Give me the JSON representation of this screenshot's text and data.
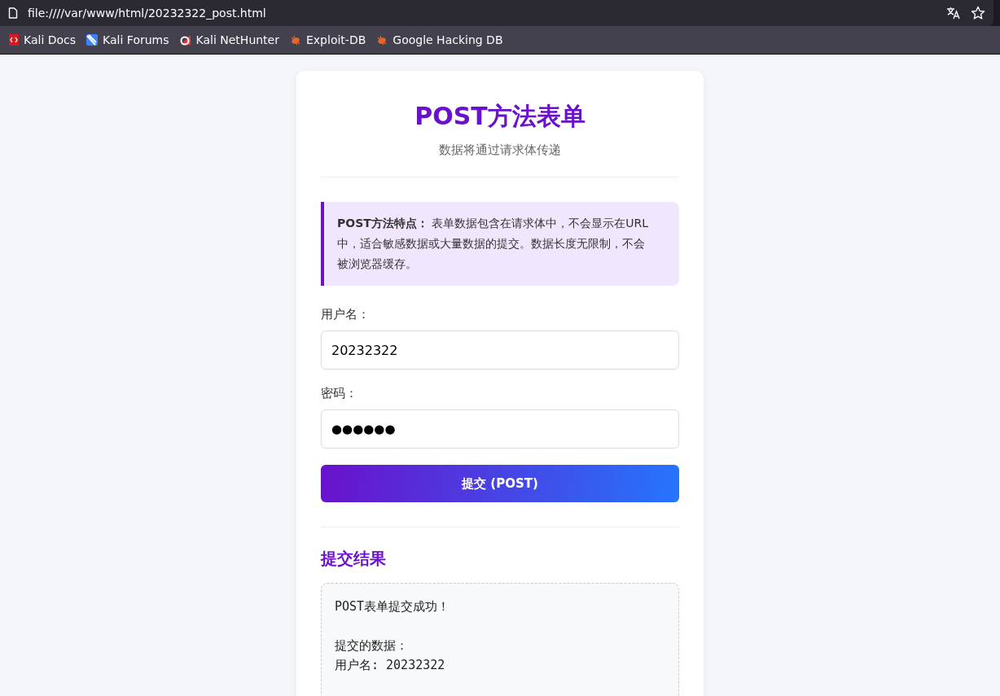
{
  "address_bar": {
    "url": "file:////var/www/html/20232322_post.html"
  },
  "bookmarks": [
    {
      "label": "Kali Docs",
      "kind": "docs"
    },
    {
      "label": "Kali Forums",
      "kind": "forums"
    },
    {
      "label": "Kali NetHunter",
      "kind": "nethunter"
    },
    {
      "label": "Exploit-DB",
      "kind": "bug"
    },
    {
      "label": "Google Hacking DB",
      "kind": "bug"
    }
  ],
  "form": {
    "title": "POST方法表单",
    "subtitle": "数据将通过请求体传递",
    "info": "**POST方法特点：** 表单数据包含在请求体中，不会显示在URL中，适合敏感数据或大量数据的提交。数据长度无限制，不会被浏览器缓存。",
    "fields": [
      {
        "label": "用户名：",
        "value": "20232322",
        "kind": "text"
      },
      {
        "label": "密码：",
        "value": "●●●●●●",
        "kind": "password"
      }
    ],
    "submit": "提交 (POST)"
  },
  "result": {
    "heading": "提交结果",
    "message": "POST表单提交成功！",
    "details": [
      "提交的数据：",
      "用户名: 20232322"
    ]
  }
}
